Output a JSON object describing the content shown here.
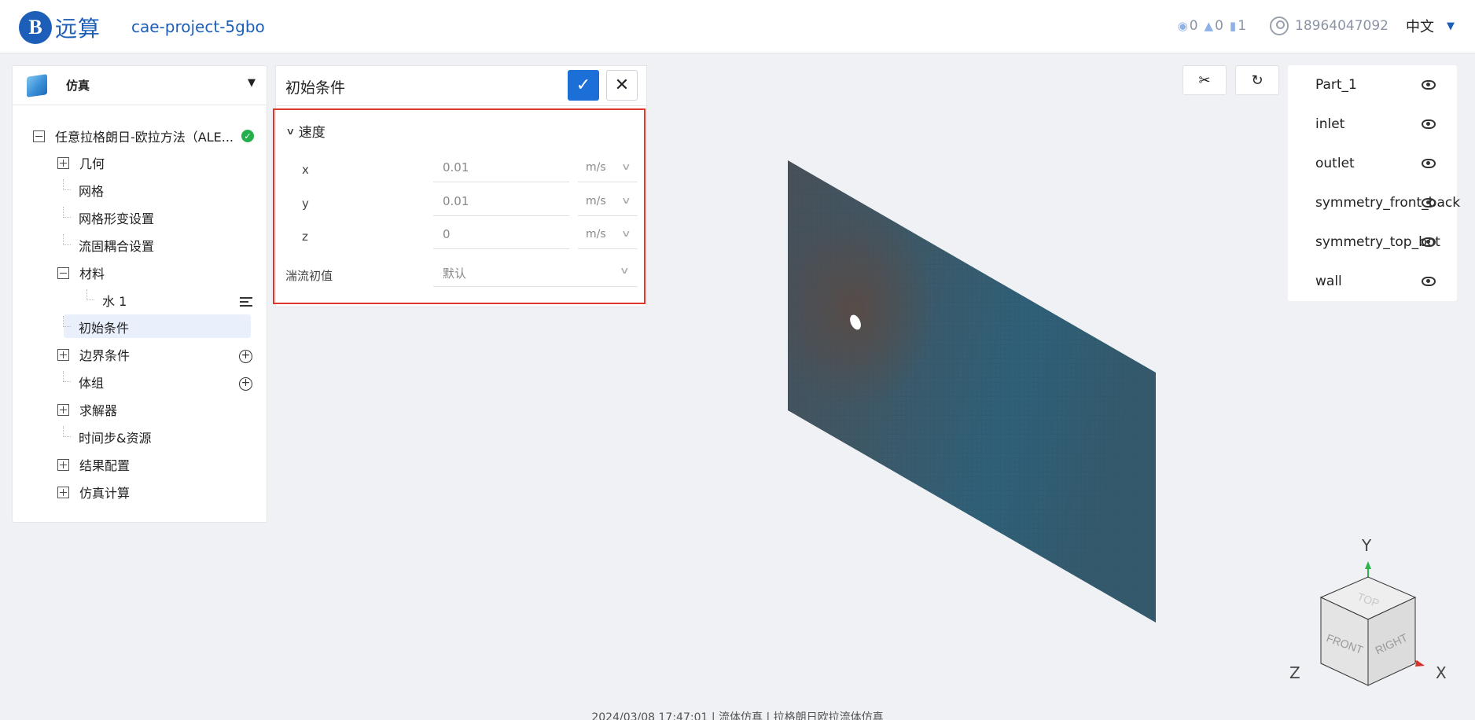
{
  "header": {
    "logo_mark": "B",
    "logo_text": "远算",
    "project_name": "cae-project-5gbo",
    "views": "0",
    "likes": "0",
    "copies": "1",
    "user": "18964047092",
    "language": "中文"
  },
  "left_panel": {
    "title": "仿真",
    "tree": {
      "root": "任意拉格朗日-欧拉方法（ALE...",
      "geometry": "几何",
      "mesh": "网格",
      "mesh_deform": "网格形变设置",
      "fsi": "流固耦合设置",
      "material": "材料",
      "water": "水 1",
      "initial": "初始条件",
      "boundary": "边界条件",
      "body_group": "体组",
      "solver": "求解器",
      "time_step": "时间步&资源",
      "result_config": "结果配置",
      "sim_compute": "仿真计算"
    }
  },
  "ic_panel": {
    "title": "初始条件",
    "section": "速度",
    "rows": [
      {
        "label": "x",
        "value": "0.01",
        "unit": "m/s"
      },
      {
        "label": "y",
        "value": "0.01",
        "unit": "m/s"
      },
      {
        "label": "z",
        "value": "0",
        "unit": "m/s"
      }
    ],
    "turb_label": "湍流初值",
    "turb_value": "默认"
  },
  "parts": [
    "Part_1",
    "inlet",
    "outlet",
    "symmetry_front_back",
    "symmetry_top_bot",
    "wall"
  ],
  "gizmo": {
    "y": "Y",
    "z": "Z",
    "x": "X",
    "top": "TOP",
    "front": "FRONT",
    "right": "RIGHT"
  },
  "footer": "2024/03/08  17:47:01  |  流体仿真  |  拉格朗日欧拉流体仿真",
  "colors": {
    "accent": "#1d6fd8",
    "highlight": "#e0372c",
    "ok": "#23b04b"
  }
}
